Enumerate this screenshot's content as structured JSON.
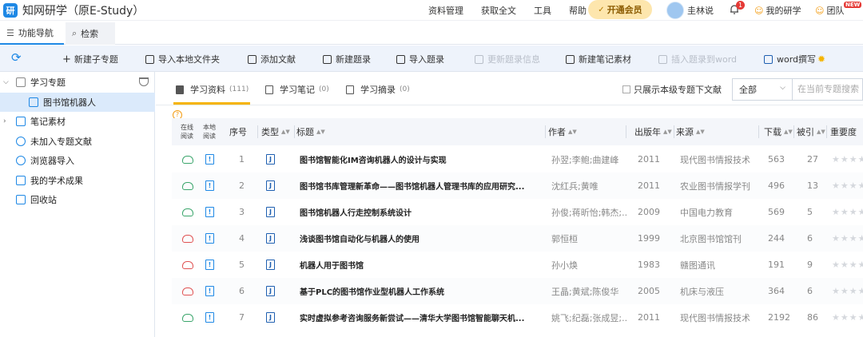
{
  "app": {
    "title": "知网研学（原E-Study）",
    "logo_text": "研"
  },
  "top_menu": [
    "资料管理",
    "获取全文",
    "工具",
    "帮助"
  ],
  "vip": {
    "label": "开通会员"
  },
  "user": {
    "name": "圭林说",
    "notif_count": "1",
    "my_research": "我的研学",
    "team": "团队",
    "new_badge": "NEW"
  },
  "tabs": [
    {
      "label": "功能导航"
    },
    {
      "label": "检索"
    }
  ],
  "toolbar": {
    "refresh": "",
    "items": [
      {
        "label": "新建子专题",
        "enabled": true
      },
      {
        "label": "导入本地文件夹",
        "enabled": true
      },
      {
        "label": "添加文献",
        "enabled": true
      },
      {
        "label": "新建题录",
        "enabled": true
      },
      {
        "label": "导入题录",
        "enabled": true
      },
      {
        "label": "更新题录信息",
        "enabled": false
      },
      {
        "label": "新建笔记素材",
        "enabled": true
      },
      {
        "label": "插入题录到word",
        "enabled": false
      },
      {
        "label": "word撰写",
        "enabled": true
      }
    ]
  },
  "sidebar": {
    "items": [
      {
        "label": "学习专题"
      },
      {
        "label": "图书馆机器人"
      },
      {
        "label": "笔记素材"
      },
      {
        "label": "未加入专题文献"
      },
      {
        "label": "浏览器导入"
      },
      {
        "label": "我的学术成果"
      },
      {
        "label": "回收站"
      }
    ]
  },
  "subtabs": [
    {
      "label": "学习资料",
      "count": "(111)"
    },
    {
      "label": "学习笔记",
      "count": "(0)"
    },
    {
      "label": "学习摘录",
      "count": "(0)"
    }
  ],
  "only_checkbox": "只展示本级专题下文献",
  "filter_select": "全部",
  "search_placeholder": "在当前专题搜索",
  "columns": {
    "online": [
      "在线",
      "阅读"
    ],
    "local": [
      "本地",
      "阅读"
    ],
    "index": "序号",
    "type": "类型",
    "title": "标题",
    "author": "作者",
    "year": "出版年",
    "source": "来源",
    "downloads": "下载",
    "cited": "被引",
    "importance": "重要度"
  },
  "rows": [
    {
      "idx": "1",
      "online": "green",
      "title": "图书馆智能化IM咨询机器人的设计与实现",
      "author": "孙翌;李鲍;曲建峰",
      "year": "2011",
      "source": "现代图书情报技术",
      "downloads": "563",
      "cited": "27"
    },
    {
      "idx": "2",
      "online": "green",
      "title": "图书馆书库管理新革命——图书馆机器人管理书库的应用研究...",
      "author": "沈红兵;黄唯",
      "year": "2011",
      "source": "农业图书情报学刊",
      "downloads": "496",
      "cited": "13"
    },
    {
      "idx": "3",
      "online": "green",
      "title": "图书馆机器人行走控制系统设计",
      "author": "孙俊;蒋昕怡;韩杰;...",
      "year": "2009",
      "source": "中国电力教育",
      "downloads": "569",
      "cited": "5"
    },
    {
      "idx": "4",
      "online": "red",
      "title": "浅谈图书馆自动化与机器人的使用",
      "author": "郭恒桓",
      "year": "1999",
      "source": "北京图书馆馆刊",
      "downloads": "244",
      "cited": "6"
    },
    {
      "idx": "5",
      "online": "red",
      "title": "机器人用于图书馆",
      "author": "孙小焕",
      "year": "1983",
      "source": "赣图通讯",
      "downloads": "191",
      "cited": "9"
    },
    {
      "idx": "6",
      "online": "red",
      "title": "基于PLC的图书馆作业型机器人工作系统",
      "author": "王晶;黄斌;陈俊华",
      "year": "2005",
      "source": "机床与液压",
      "downloads": "364",
      "cited": "6"
    },
    {
      "idx": "7",
      "online": "green",
      "title": "实时虚拟参考咨询服务新尝试——清华大学图书馆智能聊天机...",
      "author": "姚飞;纪磊;张成昱;...",
      "year": "2011",
      "source": "现代图书情报技术",
      "downloads": "2192",
      "cited": "86"
    }
  ],
  "type_icon": "J",
  "local_icon": "!",
  "stars": "★★★★★"
}
